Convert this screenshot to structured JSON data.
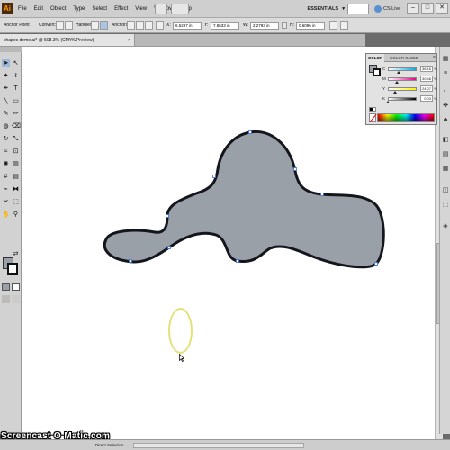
{
  "menubar": {
    "app_logo": "Ai",
    "items": [
      "File",
      "Edit",
      "Object",
      "Type",
      "Select",
      "Effect",
      "View",
      "Window",
      "Help"
    ],
    "workspace": "ESSENTIALS",
    "cslive": "CS Live",
    "window_controls": [
      "–",
      "□",
      "✕"
    ]
  },
  "controlbar": {
    "anchor_point_label": "Anchor Point",
    "convert_label": "Convert:",
    "handles_label": "Handles:",
    "anchors_label": "Anchors:",
    "x_label": "X:",
    "x_value": "6.5297 in",
    "y_label": "Y:",
    "y_value": "7.8633 in",
    "w_label": "W:",
    "w_value": "2.2793 in",
    "h_label": "H:",
    "h_value": "0.6096 in"
  },
  "document": {
    "tab_title": "shapes demo.ai* @ 508.3% (CMYK/Preview)",
    "close_glyph": "×"
  },
  "color_panel": {
    "tab_color": "COLOR",
    "tab_guide": "COLOR GUIDE",
    "menu_glyph": "≡",
    "channels": [
      {
        "letter": "C",
        "value": "36.16",
        "level": 0.36,
        "gradient_end": "#00aeef"
      },
      {
        "letter": "M",
        "value": "30.46",
        "level": 0.3,
        "gradient_end": "#ec008c"
      },
      {
        "letter": "Y",
        "value": "24.07",
        "level": 0.24,
        "gradient_end": "#fff200"
      },
      {
        "letter": "K",
        "value": "0.03",
        "level": 0.0,
        "gradient_end": "#000000"
      }
    ],
    "pct": "%"
  },
  "colors": {
    "shape_fill": "#9aa0a8",
    "shape_stroke": "#15151e",
    "selection_blue": "#3a6fd0",
    "cursor_highlight": "#e4e07a"
  },
  "statusbar": {
    "tool": "Direct Selection"
  },
  "watermark": "Screencast-O-Matic.com",
  "icons": {
    "selection": "➤",
    "direct_selection": "↖",
    "magic_wand": "✦",
    "lasso": "ℓ",
    "pen": "✒",
    "type": "T",
    "line": "╲",
    "rect": "▭",
    "brush": "✎",
    "pencil": "✏",
    "blob": "◍",
    "eraser": "⌫",
    "rotate": "↻",
    "scale": "⤡",
    "warp": "≈",
    "free_transform": "⊡",
    "symbol_sprayer": "✺",
    "graph": "▥",
    "mesh": "#",
    "gradient": "▤",
    "eyedropper": "⌁",
    "blend": "⧓",
    "slice": "✂",
    "artboard": "⬚",
    "hand": "✋",
    "zoom": "⚲",
    "swap": "⇄",
    "dock_glyphs": [
      "▦",
      "≡",
      "◐",
      "✤",
      "♣",
      "◧",
      "▤",
      "▦",
      "◫",
      "⬚",
      "◈"
    ]
  }
}
